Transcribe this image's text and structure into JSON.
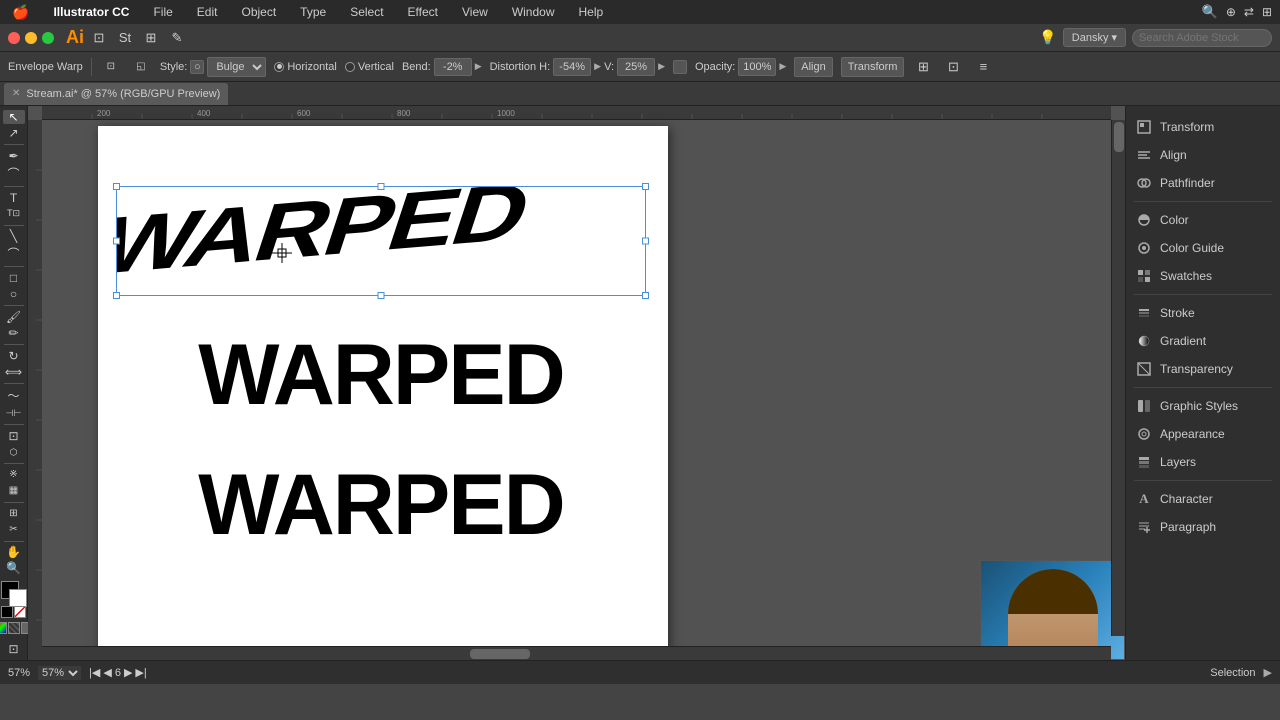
{
  "app": {
    "name": "Illustrator CC",
    "logo": "Ai"
  },
  "macos": {
    "apple": "🍎"
  },
  "menubar": {
    "items": [
      "Illustrator CC",
      "File",
      "Edit",
      "Object",
      "Type",
      "Select",
      "Effect",
      "View",
      "Window",
      "Help"
    ]
  },
  "titlebar": {
    "icons": [
      "◼",
      "◼",
      "◼",
      "◼",
      "◼"
    ]
  },
  "toolbar": {
    "icons": [
      "⟨",
      "⟩",
      "□",
      "◱",
      "≡",
      "✎"
    ],
    "user_label": "Dansky",
    "search_placeholder": "Search Adobe Stock"
  },
  "envelope_warp": {
    "label": "Envelope Warp",
    "style_label": "Style:",
    "style_value": "Bulge",
    "horizontal_label": "Horizontal",
    "vertical_label": "Vertical",
    "bend_label": "Bend:",
    "bend_value": "-2%",
    "distortion_label": "Distortion H:",
    "distortion_h_value": "-54%",
    "distortion_v_label": "V:",
    "distortion_v_value": "25%",
    "opacity_label": "Opacity:",
    "opacity_value": "100%",
    "align_label": "Align",
    "transform_label": "Transform"
  },
  "tab": {
    "close": "✕",
    "title": "Stream.ai* @ 57% (RGB/GPU Preview)"
  },
  "canvas": {
    "zoom": "57%",
    "mode": "Selection",
    "page": "6"
  },
  "warped_text": {
    "top": "WARPED",
    "middle": "WARPED",
    "bottom": "WARPED"
  },
  "right_panel": {
    "items": [
      {
        "id": "transform",
        "label": "Transform",
        "icon": "⊞"
      },
      {
        "id": "align",
        "label": "Align",
        "icon": "≡"
      },
      {
        "id": "pathfinder",
        "label": "Pathfinder",
        "icon": "⊕"
      },
      {
        "id": "color",
        "label": "Color",
        "icon": "○"
      },
      {
        "id": "color-guide",
        "label": "Color Guide",
        "icon": "◎"
      },
      {
        "id": "swatches",
        "label": "Swatches",
        "icon": "⊞"
      },
      {
        "id": "stroke",
        "label": "Stroke",
        "icon": "≡"
      },
      {
        "id": "gradient",
        "label": "Gradient",
        "icon": "◐"
      },
      {
        "id": "transparency",
        "label": "Transparency",
        "icon": "◱"
      },
      {
        "id": "graphic-styles",
        "label": "Graphic Styles",
        "icon": "⊞"
      },
      {
        "id": "appearance",
        "label": "Appearance",
        "icon": "◎"
      },
      {
        "id": "layers",
        "label": "Layers",
        "icon": "◱"
      },
      {
        "id": "character",
        "label": "Character",
        "icon": "A"
      },
      {
        "id": "paragraph",
        "label": "Paragraph",
        "icon": "≡"
      }
    ]
  },
  "statusbar": {
    "zoom": "57%",
    "page": "6",
    "mode": "Selection"
  }
}
